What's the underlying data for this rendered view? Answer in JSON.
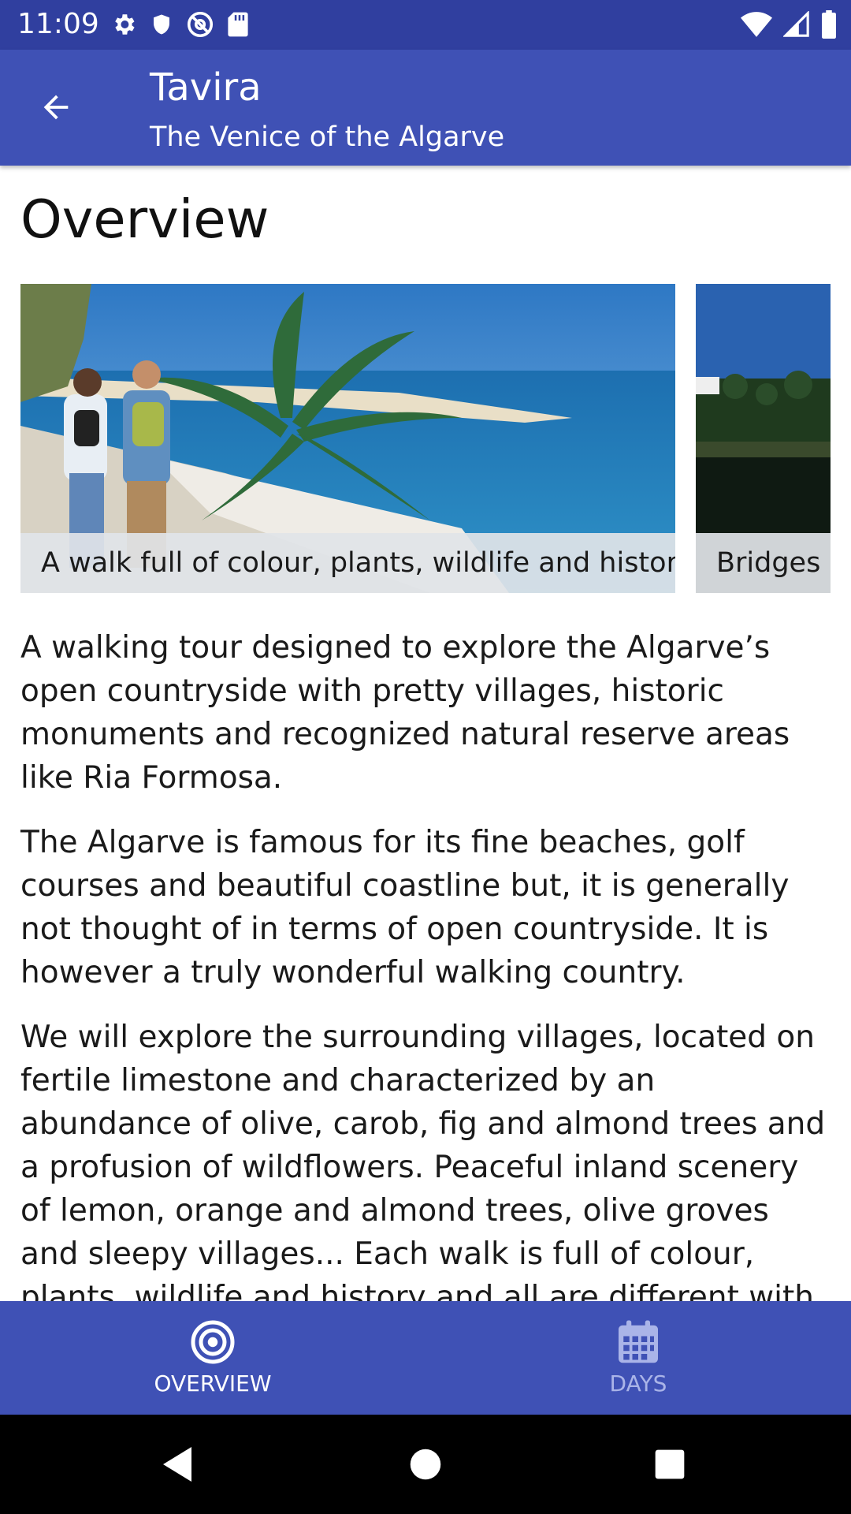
{
  "status_bar": {
    "time": "11:09",
    "left_icons": [
      "gear-icon",
      "shield-icon",
      "at-sign-icon",
      "sd-card-icon"
    ],
    "right_icons": [
      "wifi-icon",
      "cell-signal-icon",
      "battery-icon"
    ]
  },
  "app_bar": {
    "title": "Tavira",
    "subtitle": "The Venice of the Algarve",
    "back_icon": "arrow-back-icon"
  },
  "main": {
    "section_title": "Overview",
    "carousel": [
      {
        "caption": "A walk full of colour, plants, wildlife and history."
      },
      {
        "caption": "Bridges a"
      }
    ],
    "paragraphs": [
      "A walking tour designed to explore the Algarve’s open countryside with pretty villages, historic monuments and recognized natural reserve areas like Ria Formosa.",
      "The Algarve is famous for its fine beaches, golf courses and beautiful coastline but, it is generally not thought of in terms of open countryside. It is however a truly wonderful walking country.",
      "We will explore the surrounding villages, located on fertile limestone and characterized by an abundance of olive, carob, fig and almond trees and a profusion of wildflowers. Peaceful inland scenery of lemon, orange and almond trees, olive groves and sleepy villages... Each walk is full of colour, plants, wildlife and history and all are different with unique sights. Each day’s"
    ]
  },
  "bottom_nav": {
    "items": [
      {
        "label": "OVERVIEW",
        "icon": "target-icon",
        "active": true
      },
      {
        "label": "DAYS",
        "icon": "calendar-icon",
        "active": false
      }
    ]
  },
  "system_nav": {
    "buttons": [
      "back-triangle-icon",
      "home-circle-icon",
      "recents-square-icon"
    ]
  },
  "colors": {
    "status_bar": "#303f9f",
    "primary": "#3f51b5",
    "nav_inactive": "#aab4e8"
  }
}
